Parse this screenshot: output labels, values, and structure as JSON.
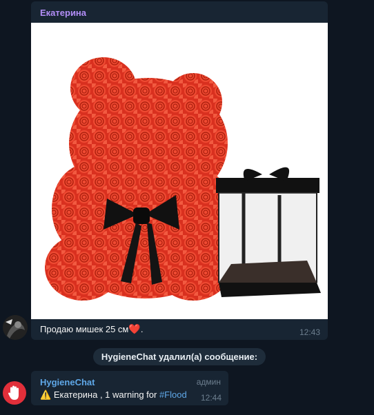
{
  "messages": [
    {
      "author": "Екатерина",
      "caption": "Продаю мишек 25 см",
      "caption_emoji": "❤️",
      "caption_tail": ".",
      "time": "12:43",
      "photo": "red rose teddy bear with black bow and clear gift box"
    }
  ],
  "service_message": "HygieneChat удалил(а) сообщение:",
  "bot_message": {
    "author": "HygieneChat",
    "role": "админ",
    "warning_icon": "⚠️",
    "text": "Екатерина , 1 warning for ",
    "hashtag": "#Flood",
    "time": "12:44"
  },
  "colors": {
    "background": "#0e1621",
    "bubble": "#182533",
    "author1": "#b38ef8",
    "author2": "#5fa8e8",
    "timestamp": "#6d7f8f"
  }
}
